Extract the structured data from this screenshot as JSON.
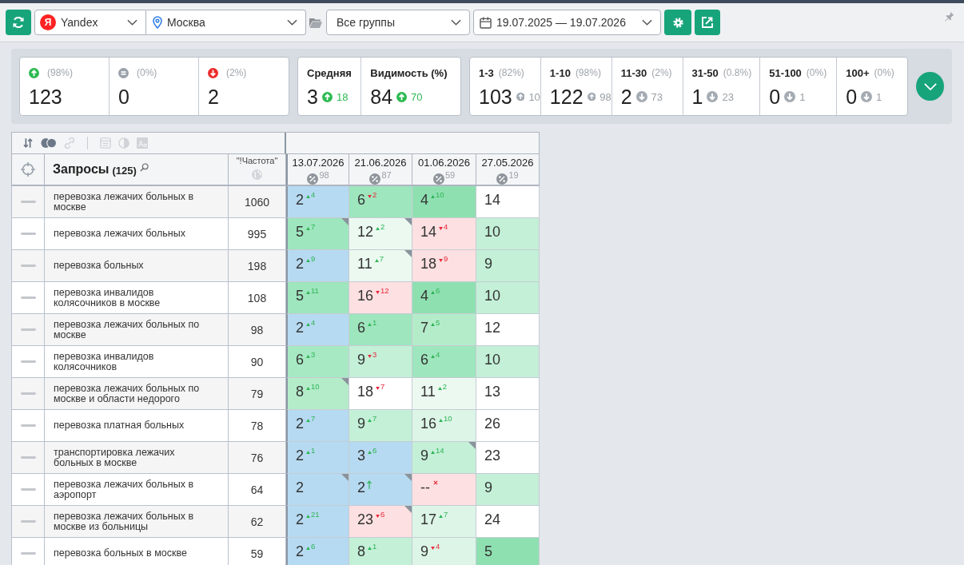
{
  "toolbar": {
    "engine": {
      "logo": "Я",
      "name": "Yandex"
    },
    "region": "Москва",
    "group": "Все группы",
    "date_range": "19.07.2025 — 19.07.2026"
  },
  "summary": {
    "trend_counts": [
      {
        "kind": "up",
        "percent": "(98%)",
        "value": "123"
      },
      {
        "kind": "same",
        "percent": "(0%)",
        "value": "0"
      },
      {
        "kind": "down",
        "percent": "(2%)",
        "value": "2"
      }
    ],
    "metrics": [
      {
        "label": "Средняя",
        "value": "3",
        "kind": "up",
        "change": "18"
      },
      {
        "label": "Видимость (%)",
        "value": "84",
        "kind": "up",
        "change": "70"
      }
    ],
    "ranges": [
      {
        "label": "1-3",
        "percent": "(82%)",
        "value": "103",
        "kind": "up",
        "change": "10"
      },
      {
        "label": "1-10",
        "percent": "(98%)",
        "value": "122",
        "kind": "up",
        "change": "98"
      },
      {
        "label": "11-30",
        "percent": "(2%)",
        "value": "2",
        "kind": "down",
        "change": "73"
      },
      {
        "label": "31-50",
        "percent": "(0.8%)",
        "value": "1",
        "kind": "down",
        "change": "23"
      },
      {
        "label": "51-100",
        "percent": "(0%)",
        "value": "0",
        "kind": "down",
        "change": "1"
      },
      {
        "label": "100+",
        "percent": "(0%)",
        "value": "0",
        "kind": "down",
        "change": "1"
      }
    ]
  },
  "table": {
    "tools": [
      {
        "kind": "sort",
        "disabled": false
      },
      {
        "kind": "merge",
        "disabled": false
      },
      {
        "kind": "link",
        "disabled": true
      },
      {
        "kind": "separator"
      },
      {
        "kind": "columns",
        "disabled": true
      },
      {
        "kind": "contrast",
        "disabled": true
      },
      {
        "kind": "font",
        "disabled": true
      }
    ],
    "title": "Запросы",
    "count": "(125)",
    "frequency_header": "\"!Частота\"",
    "dates": [
      {
        "date": "13.07.2026",
        "score": "98"
      },
      {
        "date": "21.06.2026",
        "score": "87"
      },
      {
        "date": "01.06.2026",
        "score": "59"
      },
      {
        "date": "27.05.2026",
        "score": "19"
      }
    ],
    "rows": [
      {
        "query": "перевозка лежачих больных в москве",
        "frequency": "1060",
        "cells": [
          {
            "rank": "2",
            "kind": "up",
            "delta": "4",
            "color": "#b6daf1",
            "flagged": false
          },
          {
            "rank": "6",
            "kind": "down",
            "delta": "2",
            "color": "#9ee6bd",
            "flagged": false
          },
          {
            "rank": "4",
            "kind": "up",
            "delta": "10",
            "color": "#8fe0b1",
            "flagged": false
          },
          {
            "rank": "14",
            "kind": "plain",
            "color": "#ffffff",
            "flagged": false
          }
        ]
      },
      {
        "query": "перевозка лежачих больных",
        "frequency": "995",
        "cells": [
          {
            "rank": "5",
            "kind": "up",
            "delta": "7",
            "color": "#9ee6bd",
            "flagged": true
          },
          {
            "rank": "12",
            "kind": "up",
            "delta": "2",
            "color": "#ebf9f0",
            "flagged": true
          },
          {
            "rank": "14",
            "kind": "down",
            "delta": "4",
            "color": "#fde0e1",
            "flagged": false
          },
          {
            "rank": "10",
            "kind": "plain",
            "color": "#c3f0d7",
            "flagged": false
          }
        ]
      },
      {
        "query": "перевозка больных",
        "frequency": "198",
        "cells": [
          {
            "rank": "2",
            "kind": "up",
            "delta": "9",
            "color": "#b6daf1",
            "flagged": false
          },
          {
            "rank": "11",
            "kind": "up",
            "delta": "7",
            "color": "#ebf9f0",
            "flagged": true
          },
          {
            "rank": "18",
            "kind": "down",
            "delta": "9",
            "color": "#fde0e1",
            "flagged": false
          },
          {
            "rank": "9",
            "kind": "plain",
            "color": "#c3f0d7",
            "flagged": false
          }
        ]
      },
      {
        "query": "перевозка инвалидов колясочников в москве",
        "frequency": "108",
        "cells": [
          {
            "rank": "5",
            "kind": "up",
            "delta": "11",
            "color": "#9ee6bd",
            "flagged": false
          },
          {
            "rank": "16",
            "kind": "down",
            "delta": "12",
            "color": "#fde0e1",
            "flagged": false
          },
          {
            "rank": "4",
            "kind": "up",
            "delta": "6",
            "color": "#8fe0b1",
            "flagged": false
          },
          {
            "rank": "10",
            "kind": "plain",
            "color": "#c3f0d7",
            "flagged": false
          }
        ]
      },
      {
        "query": "перевозка лежачих больных по москве",
        "frequency": "98",
        "cells": [
          {
            "rank": "2",
            "kind": "up",
            "delta": "4",
            "color": "#b6daf1",
            "flagged": false
          },
          {
            "rank": "6",
            "kind": "up",
            "delta": "1",
            "color": "#9ee6bd",
            "flagged": false
          },
          {
            "rank": "7",
            "kind": "up",
            "delta": "5",
            "color": "#b4ecca",
            "flagged": false
          },
          {
            "rank": "12",
            "kind": "plain",
            "color": "#ffffff",
            "flagged": false
          }
        ]
      },
      {
        "query": "перевозка инвалидов колясочников",
        "frequency": "90",
        "cells": [
          {
            "rank": "6",
            "kind": "up",
            "delta": "3",
            "color": "#a6e9c3",
            "flagged": false
          },
          {
            "rank": "9",
            "kind": "down",
            "delta": "3",
            "color": "#c3f0d7",
            "flagged": false
          },
          {
            "rank": "6",
            "kind": "up",
            "delta": "4",
            "color": "#9ee6bd",
            "flagged": false
          },
          {
            "rank": "10",
            "kind": "plain",
            "color": "#c3f0d7",
            "flagged": false
          }
        ]
      },
      {
        "query": "перевозка лежачих больных по москве и области недорого",
        "frequency": "79",
        "cells": [
          {
            "rank": "8",
            "kind": "up",
            "delta": "10",
            "color": "#b4ecca",
            "flagged": true
          },
          {
            "rank": "18",
            "kind": "down",
            "delta": "7",
            "color": "#ffffff",
            "flagged": false
          },
          {
            "rank": "11",
            "kind": "up",
            "delta": "2",
            "color": "#ebf9f0",
            "flagged": false
          },
          {
            "rank": "13",
            "kind": "plain",
            "color": "#ffffff",
            "flagged": false
          }
        ]
      },
      {
        "query": "перевозка платная больных",
        "frequency": "78",
        "cells": [
          {
            "rank": "2",
            "kind": "up",
            "delta": "7",
            "color": "#b6daf1",
            "flagged": false
          },
          {
            "rank": "9",
            "kind": "up",
            "delta": "7",
            "color": "#c3f0d7",
            "flagged": false
          },
          {
            "rank": "16",
            "kind": "up",
            "delta": "10",
            "color": "#dcf5e7",
            "flagged": false
          },
          {
            "rank": "26",
            "kind": "plain",
            "color": "#ffffff",
            "flagged": false
          }
        ]
      },
      {
        "query": "транспортировка лежачих больных в москве",
        "frequency": "76",
        "cells": [
          {
            "rank": "2",
            "kind": "up",
            "delta": "1",
            "color": "#b6daf1",
            "flagged": false
          },
          {
            "rank": "3",
            "kind": "up",
            "delta": "6",
            "color": "#b6daf1",
            "flagged": false
          },
          {
            "rank": "9",
            "kind": "up",
            "delta": "14",
            "color": "#c3f0d7",
            "flagged": true
          },
          {
            "rank": "23",
            "kind": "plain",
            "color": "#ffffff",
            "flagged": false
          }
        ]
      },
      {
        "query": "перевозка лежачих больных в аэропорт",
        "frequency": "64",
        "cells": [
          {
            "rank": "2",
            "kind": "plain",
            "color": "#b6daf1",
            "flagged": true
          },
          {
            "rank": "2",
            "kind": "new",
            "color": "#b6daf1",
            "flagged": true
          },
          {
            "rank": "--",
            "kind": "lost",
            "color": "#fde0e1",
            "flagged": false
          },
          {
            "rank": "9",
            "kind": "plain",
            "color": "#c3f0d7",
            "flagged": false
          }
        ]
      },
      {
        "query": "перевозка лежачих больных в москве из больницы",
        "frequency": "62",
        "cells": [
          {
            "rank": "2",
            "kind": "up",
            "delta": "21",
            "color": "#b6daf1",
            "flagged": false
          },
          {
            "rank": "23",
            "kind": "down",
            "delta": "6",
            "color": "#fde0e1",
            "flagged": true
          },
          {
            "rank": "17",
            "kind": "up",
            "delta": "7",
            "color": "#dcf5e7",
            "flagged": false
          },
          {
            "rank": "24",
            "kind": "plain",
            "color": "#ffffff",
            "flagged": false
          }
        ]
      },
      {
        "query": "перевозка больных в москве",
        "frequency": "59",
        "cells": [
          {
            "rank": "2",
            "kind": "up",
            "delta": "6",
            "color": "#b6daf1",
            "flagged": false
          },
          {
            "rank": "8",
            "kind": "up",
            "delta": "1",
            "color": "#c3f0d7",
            "flagged": false
          },
          {
            "rank": "9",
            "kind": "down",
            "delta": "4",
            "color": "#dcf5e7",
            "flagged": false
          },
          {
            "rank": "5",
            "kind": "plain",
            "color": "#8fe0b1",
            "flagged": false
          }
        ]
      }
    ]
  }
}
